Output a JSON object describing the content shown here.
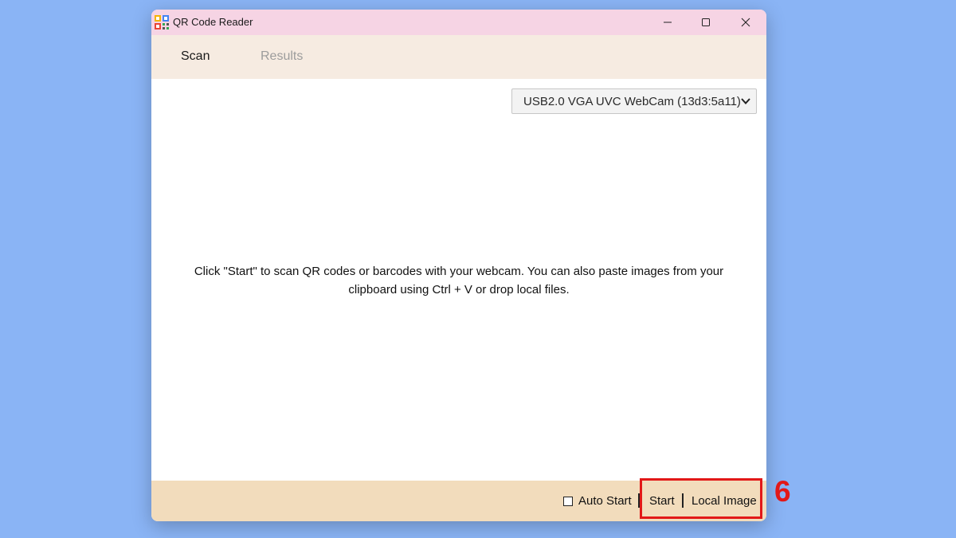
{
  "window": {
    "title": "QR Code Reader",
    "icon": "qr-app-icon"
  },
  "tabs": [
    {
      "label": "Scan",
      "active": true
    },
    {
      "label": "Results",
      "active": false
    }
  ],
  "camera": {
    "selected": "USB2.0 VGA UVC WebCam (13d3:5a11)"
  },
  "main": {
    "hint_line1": "Click \"Start\" to scan QR codes or barcodes with your webcam. You can also paste images from your",
    "hint_line2": "clipboard using Ctrl + V or drop local files."
  },
  "footer": {
    "auto_start_label": "Auto Start",
    "auto_start_checked": false,
    "start_label": "Start",
    "local_image_label": "Local Image"
  },
  "annotation": {
    "step": "6",
    "color": "#e21818"
  },
  "colors": {
    "titlebar": "#f6d4e4",
    "tabbar": "#f6ebe1",
    "footer": "#f2dcbc",
    "desktop": "#8ab4f5"
  }
}
